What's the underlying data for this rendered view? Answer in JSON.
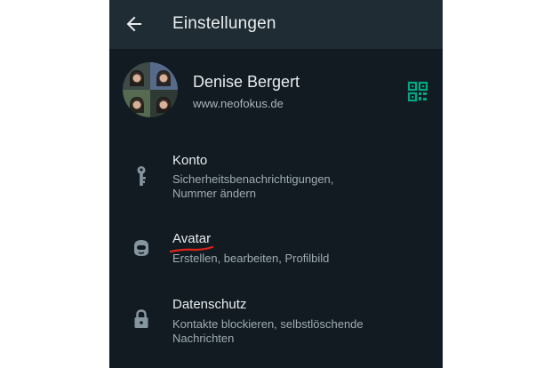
{
  "header": {
    "title": "Einstellungen",
    "back_icon": "arrow-left-icon"
  },
  "profile": {
    "name": "Denise Bergert",
    "status": "www.neofokus.de",
    "qr_icon": "qr-code-icon"
  },
  "settings": [
    {
      "icon": "key-icon",
      "title": "Konto",
      "subtitle": "Sicherheitsbenachrichtigungen, Nummer ändern"
    },
    {
      "icon": "avatar-face-icon",
      "title": "Avatar",
      "subtitle": "Erstellen, bearbeiten, Profilbild"
    },
    {
      "icon": "lock-icon",
      "title": "Datenschutz",
      "subtitle": "Kontakte blockieren, selbstlöschende Nachrichten"
    }
  ],
  "colors": {
    "background": "#121b22",
    "app_bar": "#1f2c34",
    "accent": "#00a884",
    "annotation": "#e0241b"
  }
}
